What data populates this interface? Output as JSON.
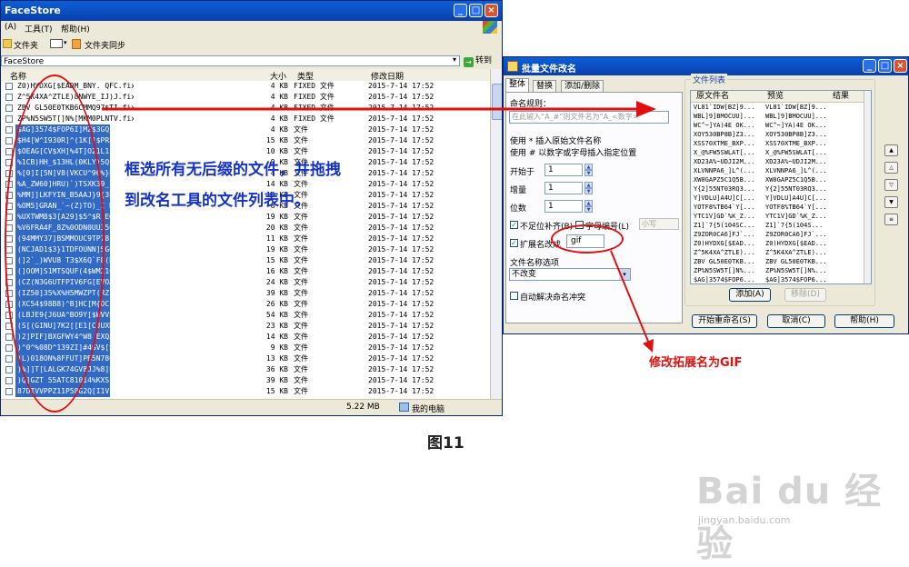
{
  "explorer": {
    "title": "FaceStore",
    "menu": [
      "(A)",
      "工具(T)",
      "帮助(H)"
    ],
    "toolbar": {
      "folders": "文件夹",
      "sync": "文件夹同步"
    },
    "address": "FaceStore",
    "go_label": "转到",
    "columns": {
      "name": "名称",
      "size": "大小",
      "type": "类型",
      "date": "修改日期"
    },
    "rows": [
      {
        "name": "Z0)HYDXG[$EADM_BNY. QFC.fixed",
        "size": "4 KB",
        "type": "FIXED 文件",
        "date": "2015-7-14 17:52",
        "sel": false
      },
      {
        "name": "Z^5K4XA^ZTLE)8NWYE_IJ)J.fixed",
        "size": "4 KB",
        "type": "FIXED 文件",
        "date": "2015-7-14 17:52",
        "sel": false
      },
      {
        "name": "ZBV GL50E0TKB6CMMQ97$TI.fixed",
        "size": "4 KB",
        "type": "FIXED 文件",
        "date": "2015-7-14 17:52",
        "sel": false
      },
      {
        "name": "ZP%N5SW5T[]N%[MKM0PLNTV.fixed",
        "size": "4 KB",
        "type": "FIXED 文件",
        "date": "2015-7-14 17:52",
        "sel": false
      },
      {
        "name": "$AG]3574$FOP6I]MZ$3GQ_K",
        "size": "4 KB",
        "type": "文件",
        "date": "2015-7-14 17:52",
        "sel": true
      },
      {
        "name": "$H4[W^I930R]^(1K[]$PR5S",
        "size": "15 KB",
        "type": "文件",
        "date": "2015-7-14 17:52",
        "sel": true
      },
      {
        "name": "$OEAG[CV$XH]%4T]O21L1}S",
        "size": "10 KB",
        "type": "文件",
        "date": "2015-7-14 17:52",
        "sel": true
      },
      {
        "name": "%1CB)HH_$13HL(0KLY)5QLC",
        "size": "9 KB",
        "type": "文件",
        "date": "2015-7-14 17:52",
        "sel": true
      },
      {
        "name": "%[0]I[5N]V8(VKCU^96%}EJ",
        "size": "4 KB",
        "type": "文件",
        "date": "2015-7-14 17:52",
        "sel": true
      },
      {
        "name": "%A_ZW60]HRU)`)TSXK39_LD",
        "size": "14 KB",
        "type": "文件",
        "date": "2015-7-14 17:52",
        "sel": true
      },
      {
        "name": "%MM]]LKFYIN_B5AAJ}9(3E[E",
        "size": "13 KB",
        "type": "文件",
        "date": "2015-7-14 17:52",
        "sel": true
      },
      {
        "name": "%OM5]GRAN_`~(Z)TO)_I HE",
        "size": "8 KB",
        "type": "文件",
        "date": "2015-7-14 17:52",
        "sel": true
      },
      {
        "name": "%UXTWM8$3[A29]$5^$R EOZ",
        "size": "19 KB",
        "type": "文件",
        "date": "2015-7-14 17:52",
        "sel": true
      },
      {
        "name": "%V6FRA4F_8Z%0ODN0UU3505",
        "size": "20 KB",
        "type": "文件",
        "date": "2015-7-14 17:52",
        "sel": true
      },
      {
        "name": "(94MMY37]BSMMOUC9TP78F7",
        "size": "11 KB",
        "type": "文件",
        "date": "2015-7-14 17:52",
        "sel": true
      },
      {
        "name": "(NCJAD1$3}1TDFOUNN]SG09",
        "size": "19 KB",
        "type": "文件",
        "date": "2015-7-14 17:52",
        "sel": true
      },
      {
        "name": "(]2`_)WVU8 T3$X6Q`F8(BT",
        "size": "15 KB",
        "type": "文件",
        "date": "2015-7-14 17:52",
        "sel": true
      },
      {
        "name": "(]OOM]S1MTSQUF(4$WM21C3",
        "size": "16 KB",
        "type": "文件",
        "date": "2015-7-14 17:52",
        "sel": true
      },
      {
        "name": "(CZ(N3G6UTFPIV6FG[EVOAN",
        "size": "24 KB",
        "type": "文件",
        "date": "2015-7-14 17:52",
        "sel": true
      },
      {
        "name": "(IZ50]35%X%H5MWZPT(RZ]O",
        "size": "39 KB",
        "type": "文件",
        "date": "2015-7-14 17:52",
        "sel": true
      },
      {
        "name": "(XC54$98B8)^B]HC[M{OC{1",
        "size": "26 KB",
        "type": "文件",
        "date": "2015-7-14 17:52",
        "sel": true
      },
      {
        "name": "(LBJE9{J6UA^BO9Y[$WVVSO",
        "size": "54 KB",
        "type": "文件",
        "date": "2015-7-14 17:52",
        "sel": true
      },
      {
        "name": "(S[(GINU]7K2[[E1[CJUXBW",
        "size": "23 KB",
        "type": "文件",
        "date": "2015-7-14 17:52",
        "sel": true
      },
      {
        "name": ")2]PIF]BXGFWY4^W8 EXQJT",
        "size": "14 KB",
        "type": "文件",
        "date": "2015-7-14 17:52",
        "sel": true
      },
      {
        "name": ")^0^%08D^139ZI]#4GV$[SS",
        "size": "9 KB",
        "type": "文件",
        "date": "2015-7-14 17:52",
        "sel": true
      },
      {
        "name": ")L)018ON%8FFUT]PB5N780S",
        "size": "13 KB",
        "type": "文件",
        "date": "2015-7-14 17:52",
        "sel": true
      },
      {
        "name": ")%]]T[LALGK74GV8JJ%8]EI",
        "size": "36 KB",
        "type": "文件",
        "date": "2015-7-14 17:52",
        "sel": true
      },
      {
        "name": ")Q]GZT 55ATC81014%KXS]A",
        "size": "39 KB",
        "type": "文件",
        "date": "2015-7-14 17:52",
        "sel": true
      },
      {
        "name": "87DIVVPPZ11P58G2Q[I1V$S",
        "size": "15 KB",
        "type": "文件",
        "date": "2015-7-14 17:52",
        "sel": true
      }
    ],
    "status_size": "5.22 MB",
    "status_location": "我的电脑"
  },
  "dialog": {
    "title": "批量文件改名",
    "tabs": [
      "整体",
      "替换",
      "添加/删除"
    ],
    "rule_label": "命名规则：",
    "rule_placeholder": "在此输入“A_#”则文件名为“A_<数字>”",
    "hint1": "使用 * 插入原始文件名称",
    "hint2": "使用 # 以数字或字母插入指定位置",
    "start_label": "开始于",
    "start_value": "1",
    "step_label": "增量",
    "step_value": "1",
    "digits_label": "位数",
    "digits_value": "1",
    "pad_label": "不足位补齐(B)",
    "letter_label": "字母编号(L)",
    "case_value": "小写",
    "ext_label": "扩展名改成",
    "ext_value": "gif",
    "option_label": "文件名称选项",
    "option_value": "不改变",
    "auto_label": "自动解决命名冲突",
    "list_label": "文件列表",
    "list_columns": {
      "orig": "原文件名",
      "preview": "预览",
      "result": "结果"
    },
    "files": [
      [
        "VL81`IDW[BZ]9...",
        "VL81`IDW[BZ]9..."
      ],
      [
        "WBL]9]BMOCUU]...",
        "WBL]9]BMOCUU]..."
      ],
      [
        "WC^~]YA)4E OK...",
        "WC^~]YA)4E OK..."
      ],
      [
        "XOY530BP8B]Z3...",
        "XOY530BP8B]Z3..."
      ],
      [
        "XSS70XTME_BXP...",
        "XSS70XTME_BXP..."
      ],
      [
        "X_@%FW5SWLAT[...",
        "X_@%FW5SWLAT[..."
      ],
      [
        "XD23A%~UDJI2M...",
        "XD23A%~UDJI2M..."
      ],
      [
        "XLVNNPA6_]L^(...",
        "XLVNNPA6_]L^(..."
      ],
      [
        "XW0GAPZ5C1Q5B...",
        "XW0GAPZ5C1Q5B..."
      ],
      [
        "Y{2]55NT03RQ3...",
        "Y{2]55NT03RQ3..."
      ],
      [
        "Y]VDLU]A4U]C[...",
        "Y]VDLU]A4U]C[..."
      ],
      [
        "YOTF8%TB64`Y[...",
        "YOTF8%TB64`Y[..."
      ],
      [
        "YTC1V]GD`%K_Z...",
        "YTC1V]GD`%K_Z..."
      ],
      [
        "Z1]`7{5(104SC...",
        "Z1]`7{5(104S..."
      ],
      [
        "Z9ZOR0CA6]FJ`...",
        "Z9ZOR0CA6]FJ`..."
      ],
      [
        "Z0)HYDXG[$EAD...",
        "Z0)HYDXG[$EAD..."
      ],
      [
        "Z^5K4XA^ZTLE)...",
        "Z^5K4XA^ZTLE)..."
      ],
      [
        "ZBV GL50E0TKB...",
        "ZBV GL50E0TKB..."
      ],
      [
        "ZP%N5SW5T[]N%...",
        "ZP%N5SW5T[]N%..."
      ],
      [
        "$AG]3574$FOP6...",
        "$AG]3574$FOP6..."
      ]
    ],
    "add_btn": "添加(A)",
    "remove_btn": "移除(D)",
    "start_btn": "开始重命名(S)",
    "cancel_btn": "取消(C)",
    "help_btn": "帮助(H)"
  },
  "annotations": {
    "drag_line1": "框选所有无后缀的文件，并拖拽",
    "drag_line2": "到改名工具的文件列表中。",
    "ext_note": "修改拓展名为GIF",
    "figure": "图11"
  },
  "watermark": {
    "brand": "Bai du 经验",
    "url": "jingyan.baidu.com"
  },
  "colors": {
    "accent_blue": "#1633c8",
    "red": "#e01010",
    "selection": "#3169c6"
  }
}
